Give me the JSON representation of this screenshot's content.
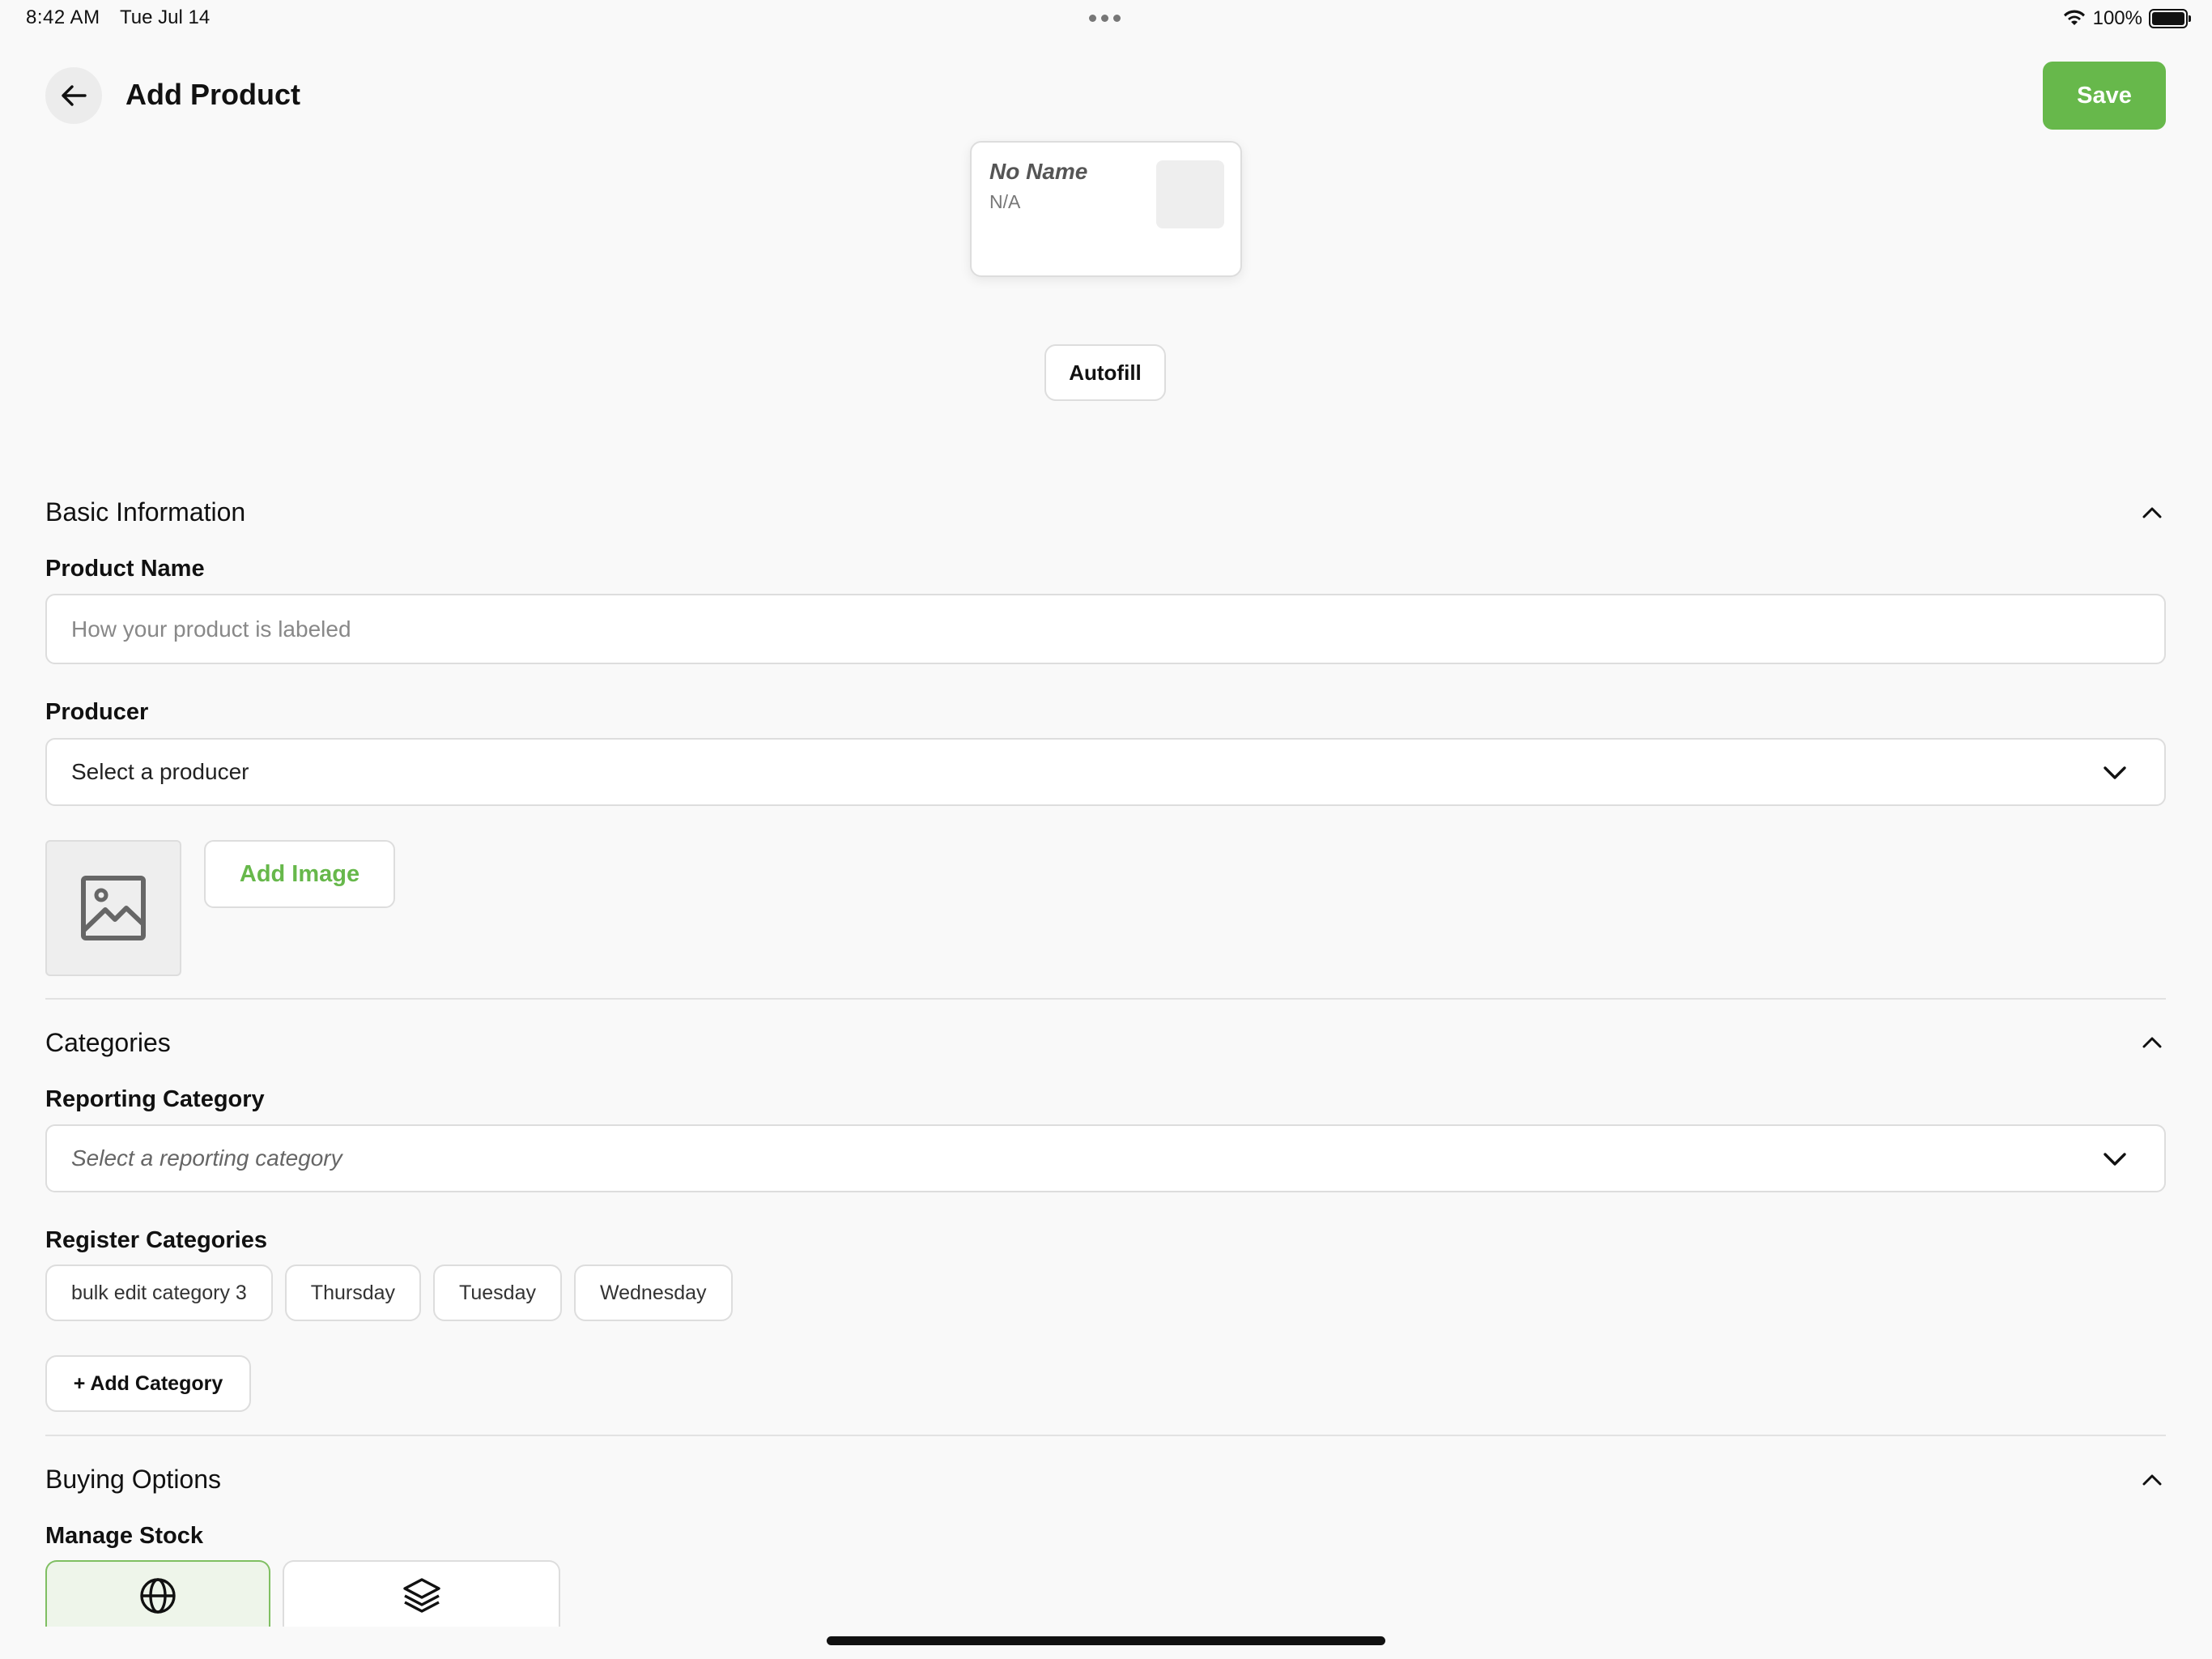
{
  "status_bar": {
    "time": "8:42 AM",
    "date": "Tue Jul 14",
    "battery": "100%"
  },
  "header": {
    "title": "Add Product",
    "save_label": "Save"
  },
  "preview": {
    "name": "No Name",
    "price": "N/A"
  },
  "autofill_label": "Autofill",
  "basic_information": {
    "title": "Basic Information",
    "product_name_label": "Product Name",
    "product_name_placeholder": "How your product is labeled",
    "producer_label": "Producer",
    "producer_value": "Select a producer",
    "add_image_label": "Add Image"
  },
  "categories": {
    "title": "Categories",
    "reporting_label": "Reporting Category",
    "reporting_placeholder": "Select a reporting category",
    "register_label": "Register Categories",
    "register_items": [
      "bulk edit category 3",
      "Thursday",
      "Tuesday",
      "Wednesday"
    ],
    "add_category_label": "+ Add Category"
  },
  "buying_options": {
    "title": "Buying Options",
    "manage_stock_label": "Manage Stock"
  },
  "colors": {
    "accent": "#67b84b",
    "background": "#f9f9f9"
  }
}
